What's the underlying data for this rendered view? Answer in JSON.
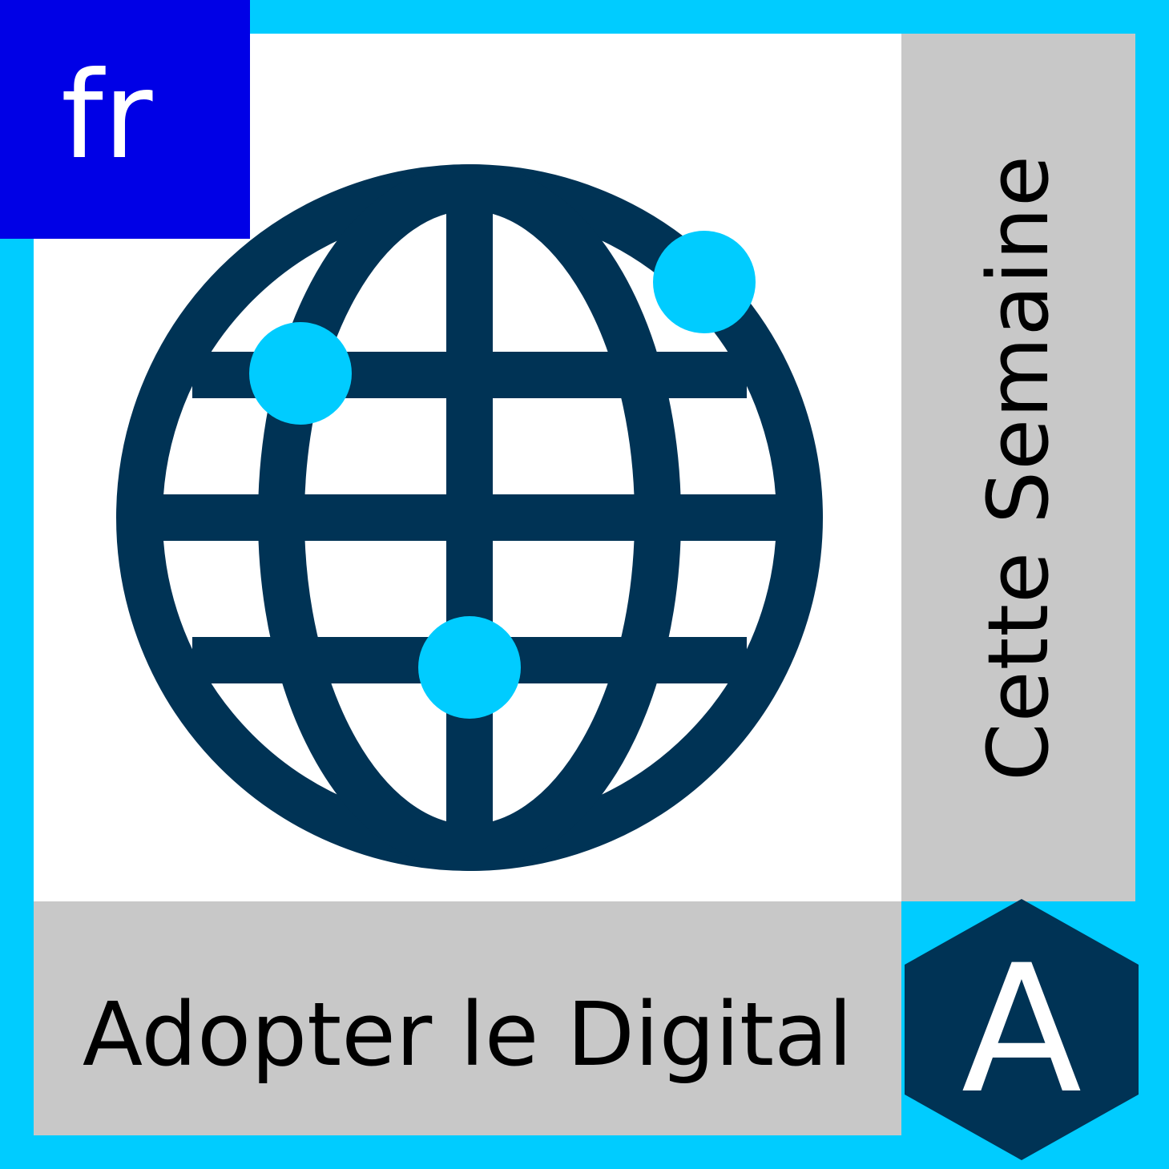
{
  "colors": {
    "border": "#00ccff",
    "badge": "#0000e6",
    "globe": "#003355",
    "dots": "#00ccff",
    "panel_gray": "#c8c8c8",
    "panel_white": "#ffffff"
  },
  "language_badge": {
    "label": "fr"
  },
  "side_panel": {
    "title": "Cette Semaine"
  },
  "bottom_panel": {
    "title": "Adopter le Digital"
  },
  "logo": {
    "letter": "A",
    "icon": "hexagon-logo"
  },
  "illustration": {
    "icon": "globe-icon",
    "dot_icon": "network-node-icon"
  }
}
